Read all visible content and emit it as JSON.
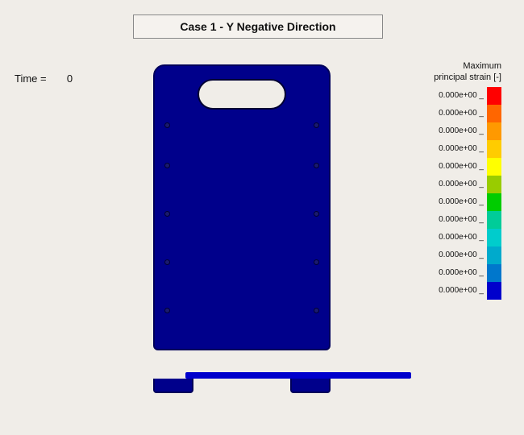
{
  "title": "Case 1 - Y Negative Direction",
  "time_label": "Time =",
  "time_value": "0",
  "legend": {
    "title_line1": "Maximum",
    "title_line2": "principal strain [-]",
    "rows": [
      {
        "label": "0.000e+00",
        "color": "#ff0000"
      },
      {
        "label": "0.000e+00",
        "color": "#ff6600"
      },
      {
        "label": "0.000e+00",
        "color": "#ff9900"
      },
      {
        "label": "0.000e+00",
        "color": "#ffcc00"
      },
      {
        "label": "0.000e+00",
        "color": "#ffff00"
      },
      {
        "label": "0.000e+00",
        "color": "#99cc00"
      },
      {
        "label": "0.000e+00",
        "color": "#00cc00"
      },
      {
        "label": "0.000e+00",
        "color": "#00cc99"
      },
      {
        "label": "0.000e+00",
        "color": "#00cccc"
      },
      {
        "label": "0.000e+00",
        "color": "#00aacc"
      },
      {
        "label": "0.000e+00",
        "color": "#0077cc"
      },
      {
        "label": "0.000e+00",
        "color": "#0000cc"
      }
    ]
  }
}
